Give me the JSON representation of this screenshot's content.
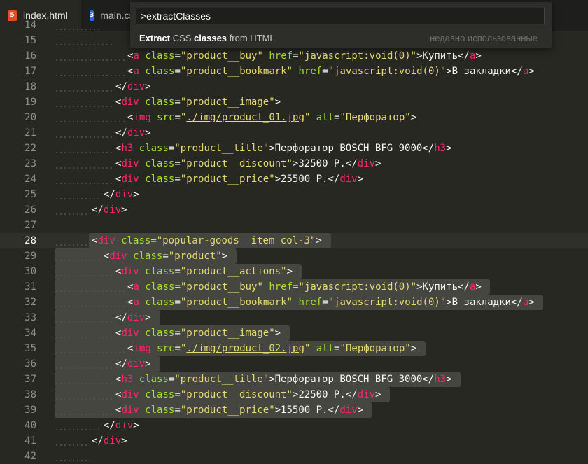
{
  "tabs": [
    {
      "label": "index.html",
      "icon": "html5-icon",
      "icon_glyph": "5",
      "color": "#e34c26"
    },
    {
      "label": "main.css",
      "icon": "css3-icon",
      "icon_glyph": "3",
      "color": "#2965f1"
    }
  ],
  "palette": {
    "value": ">extractClasses",
    "item_parts": [
      "Extract",
      " CSS ",
      "classes",
      " from HTML"
    ],
    "item_meta": "недавно использованные"
  },
  "editor": {
    "current_line": 28,
    "lines": [
      {
        "n": "14",
        "indent": 4,
        "code": ""
      },
      {
        "n": "15",
        "indent": 5,
        "code": ""
      },
      {
        "n": "16",
        "indent": 6,
        "code": "<a class=\"product__buy\" href=\"javascript:void(0)\">Купить</a>"
      },
      {
        "n": "17",
        "indent": 6,
        "code": "<a class=\"product__bookmark\" href=\"javascript:void(0)\">В закладки</a>"
      },
      {
        "n": "18",
        "indent": 5,
        "code": "</div>"
      },
      {
        "n": "19",
        "indent": 5,
        "code": "<div class=\"product__image\">"
      },
      {
        "n": "20",
        "indent": 6,
        "code": "<img src=\"./img/product_01.jpg\" alt=\"Перфоратор\">"
      },
      {
        "n": "21",
        "indent": 5,
        "code": "</div>"
      },
      {
        "n": "22",
        "indent": 5,
        "code": "<h3 class=\"product__title\">Перфоратор BOSCH BFG 9000</h3>"
      },
      {
        "n": "23",
        "indent": 5,
        "code": "<div class=\"product__discount\">32500 Р.</div>"
      },
      {
        "n": "24",
        "indent": 5,
        "code": "<div class=\"product__price\">25500 Р.</div>"
      },
      {
        "n": "25",
        "indent": 4,
        "code": "</div>"
      },
      {
        "n": "26",
        "indent": 3,
        "code": "</div>"
      },
      {
        "n": "27",
        "indent": 0,
        "code": ""
      },
      {
        "n": "28",
        "indent": 3,
        "code": "<div class=\"popular-goods__item col-3\">"
      },
      {
        "n": "29",
        "indent": 4,
        "code": "<div class=\"product\">"
      },
      {
        "n": "30",
        "indent": 5,
        "code": "<div class=\"product__actions\">"
      },
      {
        "n": "31",
        "indent": 6,
        "code": "<a class=\"product__buy\" href=\"javascript:void(0)\">Купить</a>"
      },
      {
        "n": "32",
        "indent": 6,
        "code": "<a class=\"product__bookmark\" href=\"javascript:void(0)\">В закладки</a>"
      },
      {
        "n": "33",
        "indent": 5,
        "code": "</div>"
      },
      {
        "n": "34",
        "indent": 5,
        "code": "<div class=\"product__image\">"
      },
      {
        "n": "35",
        "indent": 6,
        "code": "<img src=\"./img/product_02.jpg\" alt=\"Перфоратор\">"
      },
      {
        "n": "36",
        "indent": 5,
        "code": "</div>"
      },
      {
        "n": "37",
        "indent": 5,
        "code": "<h3 class=\"product__title\">Перфоратор BOSCH BFG 3000</h3>"
      },
      {
        "n": "38",
        "indent": 5,
        "code": "<div class=\"product__discount\">22500 Р.</div>"
      },
      {
        "n": "39",
        "indent": 5,
        "code": "<div class=\"product__price\">15500 Р.</div>"
      },
      {
        "n": "40",
        "indent": 4,
        "code": "</div>"
      },
      {
        "n": "41",
        "indent": 3,
        "code": "</div>"
      },
      {
        "n": "42",
        "indent": 3,
        "code": ""
      }
    ]
  }
}
